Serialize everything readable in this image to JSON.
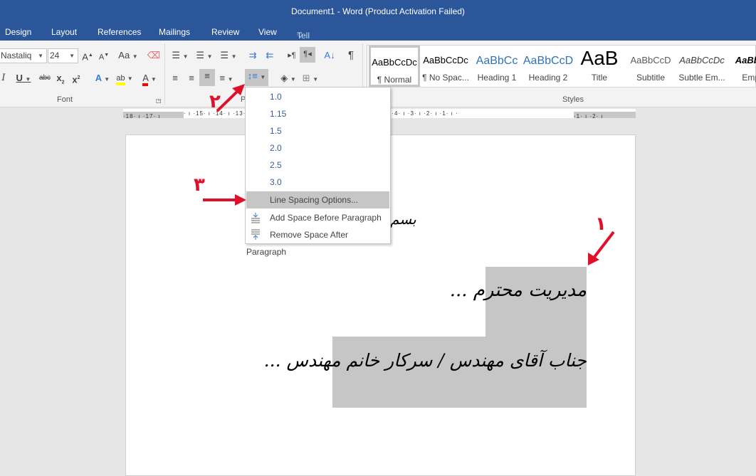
{
  "window": {
    "title": "Document1 - Word (Product Activation Failed)"
  },
  "tabs": [
    {
      "label": "Design"
    },
    {
      "label": "Layout"
    },
    {
      "label": "References"
    },
    {
      "label": "Mailings"
    },
    {
      "label": "Review"
    },
    {
      "label": "View"
    }
  ],
  "tell_me": {
    "placeholder": "Tell me what you want to do...",
    "icon": "lightbulb-icon"
  },
  "font": {
    "name": "Nastaliq",
    "size": "24",
    "group_label": "Font",
    "highlight_color": "#ffff00",
    "font_color": "#ff0000"
  },
  "paragraph": {
    "group_label": "Pa"
  },
  "styles": {
    "group_label": "Styles",
    "items": [
      {
        "preview": "AaBbCcDc",
        "name": "¶ Normal",
        "color": "#000000"
      },
      {
        "preview": "AaBbCcDc",
        "name": "¶ No Spac...",
        "color": "#000000"
      },
      {
        "preview": "AaBbCc",
        "name": "Heading 1",
        "color": "#2e74b5"
      },
      {
        "preview": "AaBbCcD",
        "name": "Heading 2",
        "color": "#2e74b5"
      },
      {
        "preview": "AaB",
        "name": "Title",
        "color": "#000000"
      },
      {
        "preview": "AaBbCcD",
        "name": "Subtitle",
        "color": "#5a5a5a"
      },
      {
        "preview": "AaBbCcDc",
        "name": "Subtle Em...",
        "color": "#404040"
      },
      {
        "preview": "AaBbCc",
        "name": "Emph",
        "color": "#000000"
      }
    ]
  },
  "ruler": {
    "left": "·18· ı ·17· ı",
    "right": "· ı ·15· ı ·14· ı ·13· ı ·12· ı ·11· ı ·10· ı ·9· ı ·8· ı ·7· ı ·6· ı ·5· ı ·4· ı ·3· ı ·2· ı ·1· ı ·",
    "end": "·1· ı ·2· ı"
  },
  "line_spacing_menu": {
    "items": [
      {
        "label": "1.0"
      },
      {
        "label": "1.15"
      },
      {
        "label": "1.5"
      },
      {
        "label": "2.0"
      },
      {
        "label": "2.5"
      },
      {
        "label": "3.0"
      },
      {
        "label": "Line Spacing Options..."
      },
      {
        "label": "Add Space Before Paragraph"
      },
      {
        "label": "Remove Space After Paragraph"
      }
    ],
    "highlighted": "Line Spacing Options..."
  },
  "document": {
    "line_partial": "بسم",
    "line1": "مدیریت محترم ...",
    "line2": "جناب آقای مهندس / سرکار خانم مهندس ..."
  },
  "annotations": [
    {
      "label": "۱"
    },
    {
      "label": "۲"
    },
    {
      "label": "۳"
    }
  ],
  "colors": {
    "accent": "#2b579a",
    "annotation": "#e0102a",
    "selection": "#c6c6c6"
  }
}
